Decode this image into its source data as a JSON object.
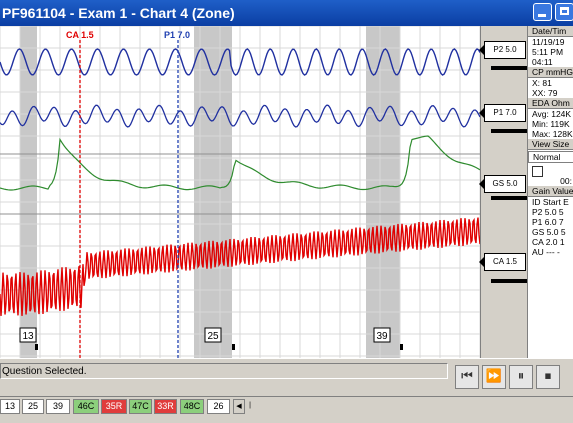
{
  "window": {
    "title": "PF961104 - Exam 1 - Chart 4 (Zone)"
  },
  "chart": {
    "markers": [
      {
        "label": "CA 1.5",
        "color": "#e00000"
      },
      {
        "label": "P1 7.0",
        "color": "#2040b0"
      }
    ],
    "question_labels": [
      "13",
      "25",
      "39"
    ]
  },
  "channels": [
    {
      "label": "P2  5.0",
      "color": "#2030a0"
    },
    {
      "label": "P1  7.0",
      "color": "#2030a0"
    },
    {
      "label": "GS  5.0",
      "color": "#2e8b2e"
    },
    {
      "label": "CA 1.5",
      "color": "#e00000"
    }
  ],
  "info_panel": {
    "datetime_header": "Date/Tim",
    "date": "11/19/19",
    "time1": "5:11 PM",
    "time2": "04:11",
    "cp": "CP mmHG",
    "x": "X:   81",
    "xx": "XX:  79",
    "eda": "EDA Ohm",
    "avg": "Avg: 124K",
    "min": "Min:  119K",
    "max": "Max: 128K",
    "view_size": "View Size",
    "view_value": "Normal",
    "counter": "00:",
    "gain_header": "Gain Value",
    "gain_columns": "ID Start E",
    "gain_rows": [
      "P2  5.0  5",
      "P1  6.0  7",
      "GS  5.0  5",
      "CA  2.0  1",
      "AU  ---  -"
    ]
  },
  "status": {
    "text": "Question Selected."
  },
  "media_controls": [
    {
      "icon": "skip-back-icon",
      "glyph": "⏮"
    },
    {
      "icon": "fast-forward-icon",
      "glyph": "⏩"
    },
    {
      "icon": "pause-icon",
      "glyph": "⏸"
    },
    {
      "icon": "stop-icon",
      "glyph": "⏹"
    }
  ],
  "question_bar": [
    {
      "label": "13",
      "state": "neutral"
    },
    {
      "label": "25",
      "state": "neutral"
    },
    {
      "label": "39",
      "state": "neutral"
    },
    {
      "label": "46C",
      "state": "green"
    },
    {
      "label": "35R",
      "state": "red"
    },
    {
      "label": "47C",
      "state": "green"
    },
    {
      "label": "33R",
      "state": "red"
    },
    {
      "label": "48C",
      "state": "green"
    },
    {
      "label": "26",
      "state": "neutral"
    }
  ]
}
